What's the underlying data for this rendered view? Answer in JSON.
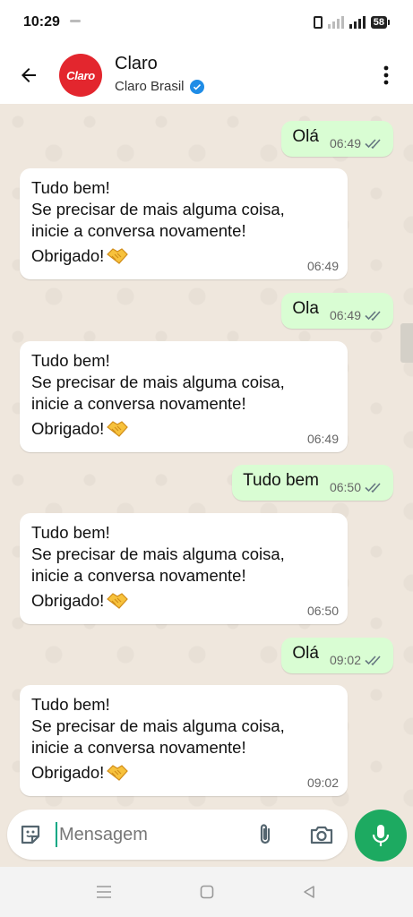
{
  "status_bar": {
    "time": "10:29",
    "battery": "58"
  },
  "header": {
    "contact_name": "Claro",
    "contact_subtitle": "Claro Brasil",
    "avatar_text": "Claro",
    "accent_color": "#1daa61",
    "verified_color": "#1f8ce6",
    "brand_color": "#e3262e"
  },
  "messages": [
    {
      "direction": "out",
      "text": "Olá",
      "time": "06:49"
    },
    {
      "direction": "in",
      "lines": [
        "Tudo bem!",
        "Se precisar de mais alguma coisa,",
        "inicie a conversa novamente!",
        "Obrigado!"
      ],
      "time": "06:49"
    },
    {
      "direction": "out",
      "text": "Ola",
      "time": "06:49"
    },
    {
      "direction": "in",
      "lines": [
        "Tudo bem!",
        "Se precisar de mais alguma coisa,",
        "inicie a conversa novamente!",
        "Obrigado!"
      ],
      "time": "06:49"
    },
    {
      "direction": "out",
      "text": "Tudo bem",
      "time": "06:50"
    },
    {
      "direction": "in",
      "lines": [
        "Tudo bem!",
        "Se precisar de mais alguma coisa,",
        "inicie a conversa novamente!",
        "Obrigado!"
      ],
      "time": "06:50"
    },
    {
      "direction": "out",
      "text": "Olá",
      "time": "09:02"
    },
    {
      "direction": "in",
      "lines": [
        "Tudo bem!",
        "Se precisar de mais alguma coisa,",
        "inicie a conversa novamente!",
        "Obrigado!"
      ],
      "time": "09:02"
    }
  ],
  "composer": {
    "placeholder": "Mensagem",
    "value": ""
  },
  "icons": {
    "back": "arrow-left-icon",
    "menu": "more-vertical-icon",
    "emoji": "sticker-icon",
    "attach": "paperclip-icon",
    "camera": "camera-icon",
    "mic": "microphone-icon",
    "read_receipt": "double-check-icon",
    "nav_recent": "menu-lines-icon",
    "nav_home": "square-icon",
    "nav_back": "triangle-back-icon"
  }
}
